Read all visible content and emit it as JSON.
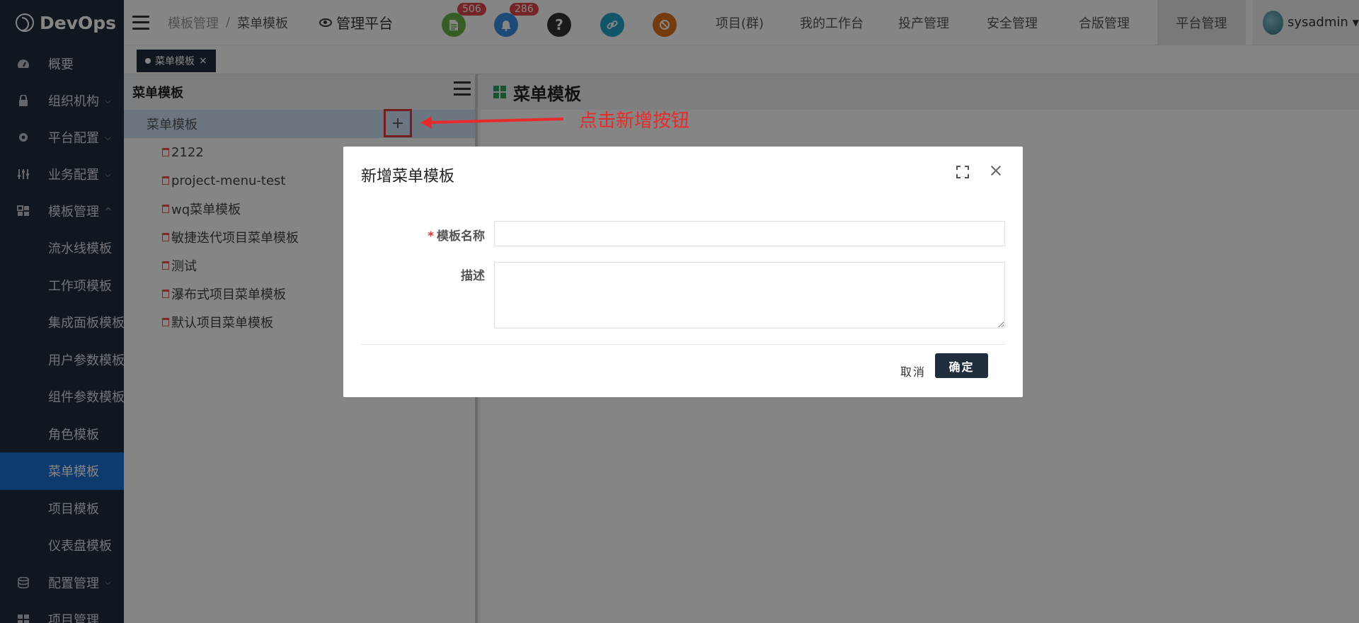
{
  "app": {
    "logo_text": "DevOps"
  },
  "sidebar": {
    "items": [
      {
        "label": "概要",
        "icon": "dashboard-icon"
      },
      {
        "label": "组织机构",
        "icon": "lock-icon"
      },
      {
        "label": "平台配置",
        "icon": "gear-icon"
      },
      {
        "label": "业务配置",
        "icon": "sliders-icon"
      },
      {
        "label": "模板管理",
        "icon": "template-icon"
      }
    ],
    "sub_items": [
      "流水线模板",
      "工作项模板",
      "集成面板模板",
      "用户参数模板",
      "组件参数模板",
      "角色模板",
      "菜单模板",
      "项目模板",
      "仪表盘模板"
    ],
    "after_items": [
      {
        "label": "配置管理",
        "icon": "database-icon"
      },
      {
        "label": "项目管理",
        "icon": "grid-icon"
      }
    ],
    "chevron_down": "⌵",
    "chevron_up": "^"
  },
  "header": {
    "breadcrumb": [
      "模板管理",
      "菜单模板"
    ],
    "breadcrumb_sep": "/",
    "platform": "管理平台",
    "badges": {
      "doc": "506",
      "bell": "286"
    },
    "nav": [
      "项目(群)",
      "我的工作台",
      "投产管理",
      "安全管理",
      "合版管理",
      "平台管理"
    ],
    "username": "sysadmin",
    "colors": {
      "doc": "#67b346",
      "bell": "#3a8ee6",
      "help": "#333333",
      "link": "#1fa3c8",
      "sync": "#e0701c"
    }
  },
  "tabs": [
    {
      "label": "菜单模板",
      "close": "×"
    }
  ],
  "tree": {
    "title": "菜单模板",
    "root": "菜单模板",
    "add_symbol": "+",
    "children": [
      "2122",
      "project-menu-test",
      "wq菜单模板",
      "敏捷迭代项目菜单模板",
      "测试",
      "瀑布式项目菜单模板",
      "默认项目菜单模板"
    ]
  },
  "content": {
    "title": "菜单模板"
  },
  "annotation": {
    "text": "点击新增按钮"
  },
  "dialog": {
    "title": "新增菜单模板",
    "name_required": "*",
    "name_label": "模板名称",
    "name_value": "",
    "desc_label": "描述",
    "desc_value": "",
    "cancel_label": "取消",
    "ok_label": "确定"
  }
}
